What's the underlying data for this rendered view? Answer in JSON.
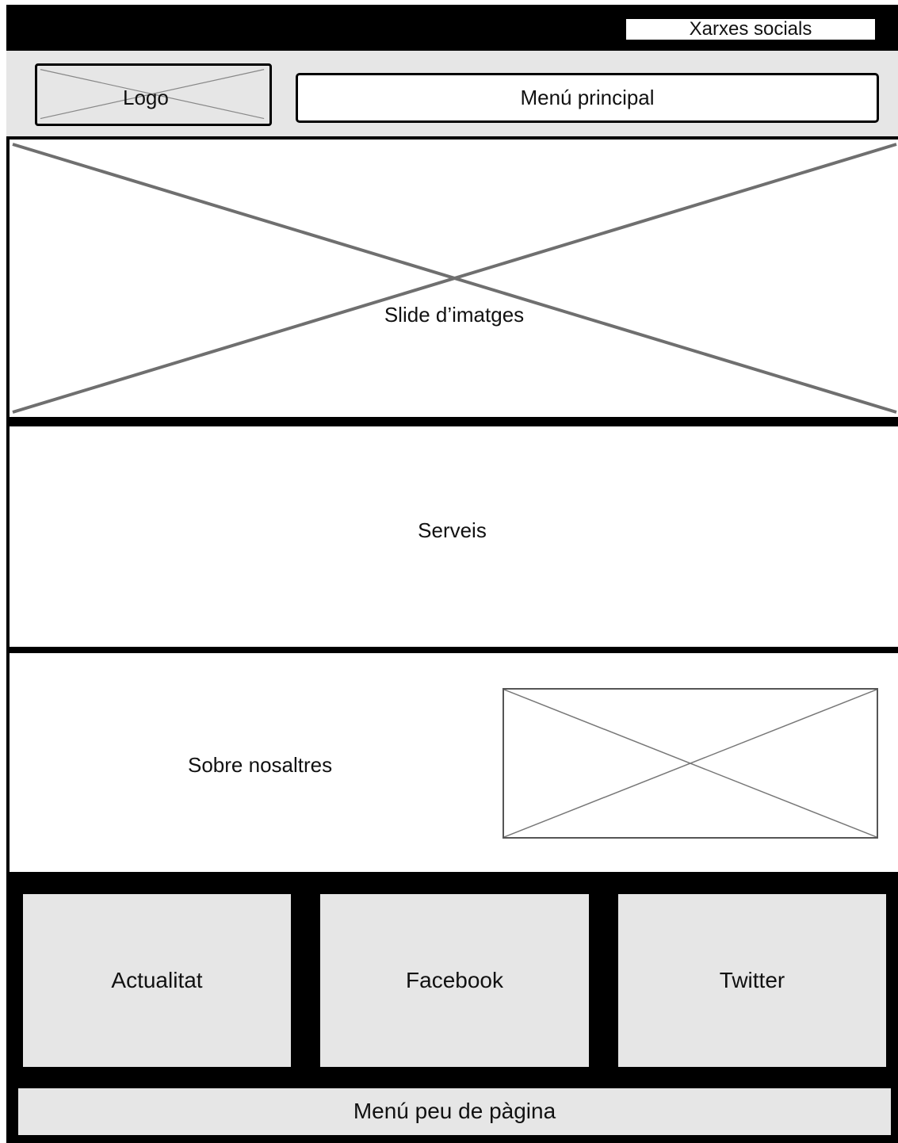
{
  "topbar": {
    "social_label": "Xarxes socials"
  },
  "header": {
    "logo_label": "Logo",
    "menu_label": "Menú principal"
  },
  "slider": {
    "label": "Slide d’imatges"
  },
  "services": {
    "label": "Serveis"
  },
  "about": {
    "label": "Sobre nosaltres"
  },
  "footer": {
    "cards": [
      {
        "label": "Actualitat"
      },
      {
        "label": "Facebook"
      },
      {
        "label": "Twitter"
      }
    ],
    "menu_label": "Menú peu de pàgina"
  },
  "colors": {
    "bar": "#000000",
    "panel": "#e6e6e6",
    "box": "#ffffff",
    "placeholder_line": "#777777"
  }
}
